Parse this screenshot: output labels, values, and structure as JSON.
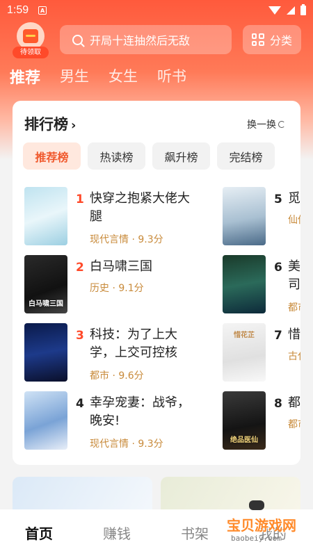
{
  "status": {
    "time": "1:59",
    "badge": "A"
  },
  "header": {
    "gift_label": "待领取",
    "search_placeholder": "开局十连抽然后无敌",
    "category_label": "分类"
  },
  "tabs": [
    {
      "label": "推荐",
      "active": true
    },
    {
      "label": "男生",
      "active": false
    },
    {
      "label": "女生",
      "active": false
    },
    {
      "label": "听书",
      "active": false
    }
  ],
  "ranking": {
    "title": "排行榜",
    "refresh_label": "换一换",
    "pills": [
      {
        "label": "推荐榜",
        "active": true
      },
      {
        "label": "热读榜",
        "active": false
      },
      {
        "label": "飙升榜",
        "active": false
      },
      {
        "label": "完结榜",
        "active": false
      }
    ],
    "books_left": [
      {
        "rank": "1",
        "title": "快穿之抱紧大佬大腿",
        "meta": "现代言情 · 9.3分"
      },
      {
        "rank": "2",
        "title": "白马啸三国",
        "meta": "历史 · 9.1分",
        "cover_text": "白马啸三国"
      },
      {
        "rank": "3",
        "title": "科技：为了上大学，上交可控核",
        "meta": "都市 · 9.6分"
      },
      {
        "rank": "4",
        "title": "幸孕宠妻：战爷，晚安!",
        "meta": "现代言情 · 9.3分"
      }
    ],
    "books_right": [
      {
        "rank": "5",
        "title": "觅",
        "meta": "仙侠"
      },
      {
        "rank": "6",
        "title": "美司",
        "meta": "都市"
      },
      {
        "rank": "7",
        "title": "惜",
        "meta": "古代",
        "cover_text": "惜花芷"
      },
      {
        "rank": "8",
        "title": "都",
        "meta": "都市",
        "cover_text": "绝品医仙"
      }
    ]
  },
  "bottom_nav": [
    {
      "label": "首页",
      "active": true
    },
    {
      "label": "赚钱",
      "active": false
    },
    {
      "label": "书架",
      "active": false
    },
    {
      "label": "我的",
      "active": false
    }
  ],
  "watermark": {
    "main": "宝贝游戏网",
    "url": "baobeiy.com"
  },
  "colors": {
    "accent": "#ff5a3c",
    "rank_hot": "#ff4a2a",
    "meta": "#c88a3a"
  }
}
